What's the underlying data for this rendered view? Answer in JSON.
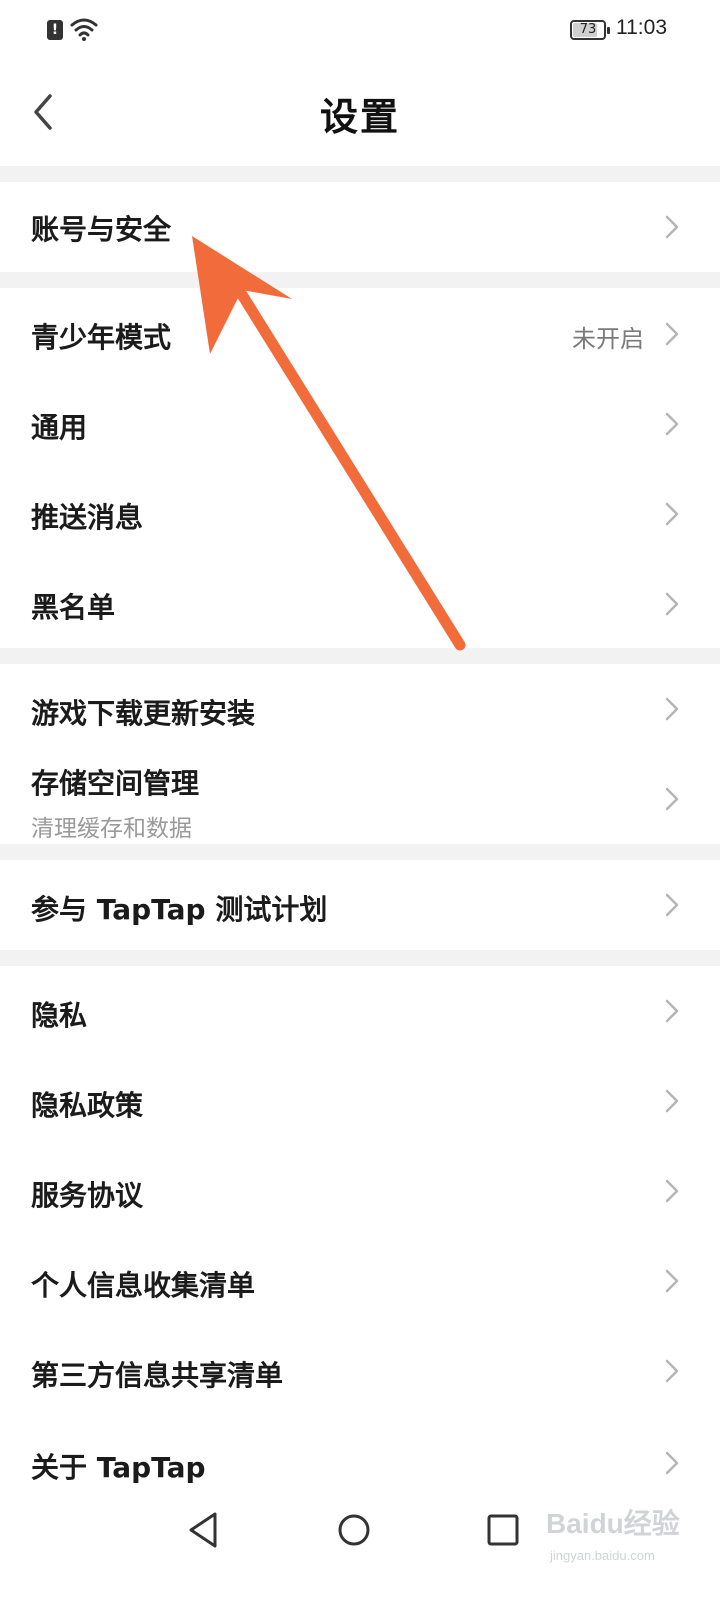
{
  "status_bar": {
    "battery_level": "73",
    "time": "11:03",
    "alert_icon": "alert-icon",
    "wifi_icon": "wifi-icon"
  },
  "header": {
    "title": "设置",
    "back_icon": "chevron-left-icon"
  },
  "sections": {
    "account": {
      "label": "账号与安全"
    },
    "youth": {
      "label": "青少年模式",
      "value": "未开启"
    },
    "general": {
      "label": "通用"
    },
    "push": {
      "label": "推送消息"
    },
    "blacklist": {
      "label": "黑名单"
    },
    "download": {
      "label": "游戏下载更新安装"
    },
    "storage": {
      "label": "存储空间管理",
      "sub": "清理缓存和数据"
    },
    "test_plan": {
      "label": "参与 TapTap 测试计划"
    },
    "privacy": {
      "label": "隐私"
    },
    "privacy_policy": {
      "label": "隐私政策"
    },
    "service": {
      "label": "服务协议"
    },
    "personal_info": {
      "label": "个人信息收集清单"
    },
    "third_party": {
      "label": "第三方信息共享清单"
    },
    "about": {
      "label": "关于 TapTap"
    }
  },
  "overlay": {
    "arrow_color": "#f26b3a"
  },
  "watermark": {
    "brand": "Baidu经验",
    "url": "jingyan.baidu.com"
  },
  "colors": {
    "separator": "#f2f2f2",
    "chevron": "#b5b5b5"
  }
}
